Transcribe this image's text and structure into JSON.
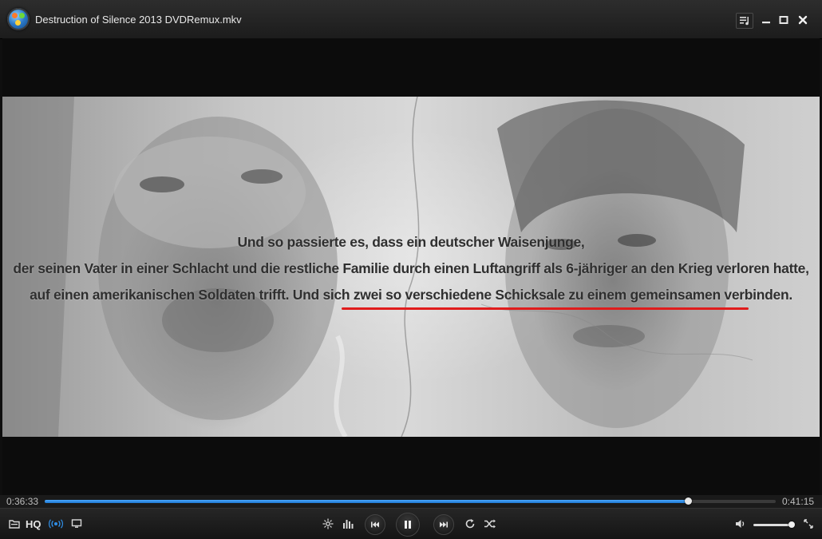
{
  "window": {
    "title": "Destruction of Silence 2013 DVDRemux.mkv"
  },
  "titlebar_buttons": {
    "playlist_icon": "playlist-icon",
    "minimize_icon": "minimize-icon",
    "maximize_icon": "maximize-icon",
    "close_icon": "close-icon"
  },
  "subtitles": {
    "line1": "Und so passierte es, dass ein deutscher Waisenjunge,",
    "line2": "der seinen Vater in einer Schlacht und die restliche Familie durch einen Luftangriff als 6-jähriger an den Krieg verloren hatte,",
    "line3": "auf einen amerikanischen Soldaten trifft. Und sich zwei so verschiedene Schicksale zu einem gemeinsamen verbinden."
  },
  "annotation": {
    "underline_color": "#e01c1c"
  },
  "playback": {
    "elapsed": "0:36:33",
    "remaining": "0:41:15",
    "progress_fraction": 0.88,
    "volume_fraction": 0.96,
    "accent_color": "#2f8de4"
  },
  "controls": {
    "hq_label": "HQ",
    "open_file_icon": "folder-icon",
    "broadcast_icon": "broadcast-icon",
    "screen_icon": "monitor-icon",
    "effects_icon": "effects-icon",
    "equalizer_icon": "equalizer-icon",
    "prev_icon": "previous-icon",
    "pause_icon": "pause-icon",
    "next_icon": "next-icon",
    "repeat_icon": "repeat-icon",
    "shuffle_icon": "shuffle-icon",
    "volume_icon": "speaker-icon",
    "fullscreen_icon": "fullscreen-icon"
  }
}
